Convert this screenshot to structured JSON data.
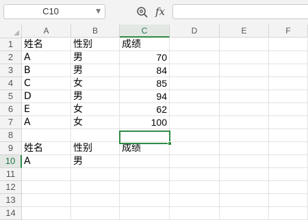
{
  "toolbar": {
    "name_box": "C10",
    "zoom_icon": "magnifier-zoom-icon",
    "fx_label": "fx",
    "formula_value": ""
  },
  "columns": [
    "A",
    "B",
    "C",
    "D",
    "E",
    "F"
  ],
  "rows": [
    "1",
    "2",
    "3",
    "4",
    "5",
    "6",
    "7",
    "8",
    "9",
    "10",
    "11",
    "12",
    "13",
    "14"
  ],
  "active_cell": {
    "column": "C",
    "row": "10"
  },
  "cells": [
    [
      "姓名",
      "性别",
      "成绩"
    ],
    [
      "A",
      "男",
      "70"
    ],
    [
      "B",
      "男",
      "84"
    ],
    [
      "C",
      "女",
      "85"
    ],
    [
      "D",
      "男",
      "94"
    ],
    [
      "E",
      "女",
      "62"
    ],
    [
      "A",
      "女",
      "100"
    ],
    [
      "",
      "",
      ""
    ],
    [
      "姓名",
      "性别",
      "成绩"
    ],
    [
      "A",
      "男",
      ""
    ],
    [
      "",
      "",
      ""
    ],
    [
      "",
      "",
      ""
    ],
    [
      "",
      "",
      ""
    ],
    [
      "",
      "",
      ""
    ]
  ],
  "colors": {
    "accent": "#2d8a43",
    "header_bg": "#f3f3f3",
    "gridline": "#e2e2e2"
  }
}
